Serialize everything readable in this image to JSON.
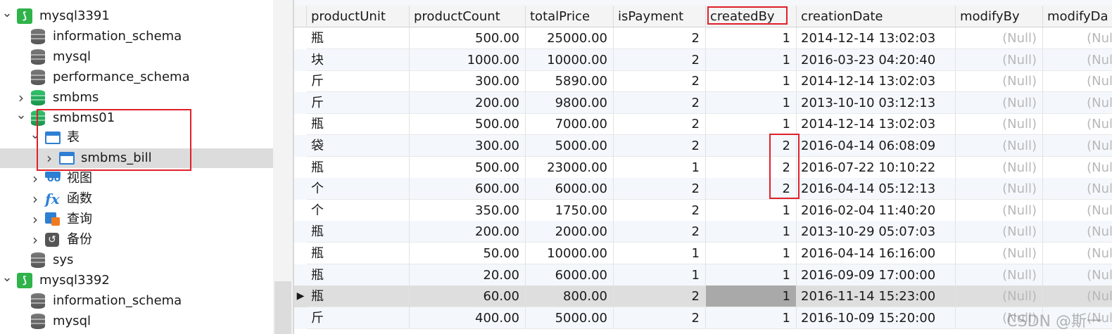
{
  "tree": {
    "items": [
      {
        "label": "mysql3391",
        "icon": "mysql-connection-icon",
        "twisty": "expanded"
      },
      {
        "label": "information_schema",
        "icon": "database-gray-icon",
        "twisty": ""
      },
      {
        "label": "mysql",
        "icon": "database-gray-icon",
        "twisty": ""
      },
      {
        "label": "performance_schema",
        "icon": "database-gray-icon",
        "twisty": ""
      },
      {
        "label": "smbms",
        "icon": "database-green-icon",
        "twisty": "collapsed"
      },
      {
        "label": "smbms01",
        "icon": "database-green-icon",
        "twisty": "expanded"
      },
      {
        "label": "表",
        "icon": "table-folder-icon",
        "twisty": "expanded"
      },
      {
        "label": "smbms_bill",
        "icon": "table-icon",
        "twisty": "collapsed"
      },
      {
        "label": "视图",
        "icon": "view-icon",
        "twisty": "collapsed"
      },
      {
        "label": "函数",
        "icon": "function-icon",
        "twisty": "collapsed"
      },
      {
        "label": "查询",
        "icon": "query-icon",
        "twisty": "collapsed"
      },
      {
        "label": "备份",
        "icon": "backup-icon",
        "twisty": "collapsed"
      },
      {
        "label": "sys",
        "icon": "database-gray-icon",
        "twisty": ""
      },
      {
        "label": "mysql3392",
        "icon": "mysql-connection-icon",
        "twisty": "expanded"
      },
      {
        "label": "information_schema",
        "icon": "database-gray-icon",
        "twisty": ""
      },
      {
        "label": "mysql",
        "icon": "database-gray-icon",
        "twisty": ""
      }
    ]
  },
  "grid": {
    "columns": [
      "productUnit",
      "productCount",
      "totalPrice",
      "isPayment",
      "createdBy",
      "creationDate",
      "modifyBy",
      "modifyDa"
    ],
    "rows": [
      [
        "瓶",
        "500.00",
        "25000.00",
        "2",
        "1",
        "2014-12-14 13:02:03",
        "(Null)",
        "(Null)"
      ],
      [
        "块",
        "1000.00",
        "10000.00",
        "2",
        "1",
        "2016-03-23 04:20:40",
        "(Null)",
        "(Null)"
      ],
      [
        "斤",
        "300.00",
        "5890.00",
        "2",
        "1",
        "2014-12-14 13:02:03",
        "(Null)",
        "(Null)"
      ],
      [
        "斤",
        "200.00",
        "9800.00",
        "2",
        "1",
        "2013-10-10 03:12:13",
        "(Null)",
        "(Null)"
      ],
      [
        "瓶",
        "500.00",
        "7000.00",
        "2",
        "1",
        "2014-12-14 13:02:03",
        "(Null)",
        "(Null)"
      ],
      [
        "袋",
        "300.00",
        "5000.00",
        "2",
        "2",
        "2016-04-14 06:08:09",
        "(Null)",
        "(Null)"
      ],
      [
        "瓶",
        "500.00",
        "23000.00",
        "1",
        "2",
        "2016-07-22 10:10:22",
        "(Null)",
        "(Null)"
      ],
      [
        "个",
        "600.00",
        "6000.00",
        "2",
        "2",
        "2016-04-14 05:12:13",
        "(Null)",
        "(Null)"
      ],
      [
        "个",
        "350.00",
        "1750.00",
        "2",
        "1",
        "2016-02-04 11:40:20",
        "(Null)",
        "(Null)"
      ],
      [
        "瓶",
        "200.00",
        "2000.00",
        "2",
        "1",
        "2013-10-29 05:07:03",
        "(Null)",
        "(Null)"
      ],
      [
        "瓶",
        "50.00",
        "10000.00",
        "1",
        "1",
        "2016-04-14 16:16:00",
        "(Null)",
        "(Null)"
      ],
      [
        "瓶",
        "20.00",
        "6000.00",
        "1",
        "1",
        "2016-09-09 17:00:00",
        "(Null)",
        "(Null)"
      ],
      [
        "瓶",
        "60.00",
        "800.00",
        "2",
        "1",
        "2016-11-14 15:23:00",
        "(Null)",
        "(Null)"
      ],
      [
        "斤",
        "400.00",
        "5000.00",
        "2",
        "1",
        "2016-10-09 15:20:00",
        "(Null)",
        "(Null)"
      ]
    ],
    "current_row_marker": "▶",
    "current_row_index": 12
  },
  "watermark": "CSDN @斯一",
  "colors": {
    "highlight": "#e0202a",
    "accent_blue": "#2d7fd3",
    "db_green": "#17934b",
    "null_text": "#b8b8b8"
  }
}
